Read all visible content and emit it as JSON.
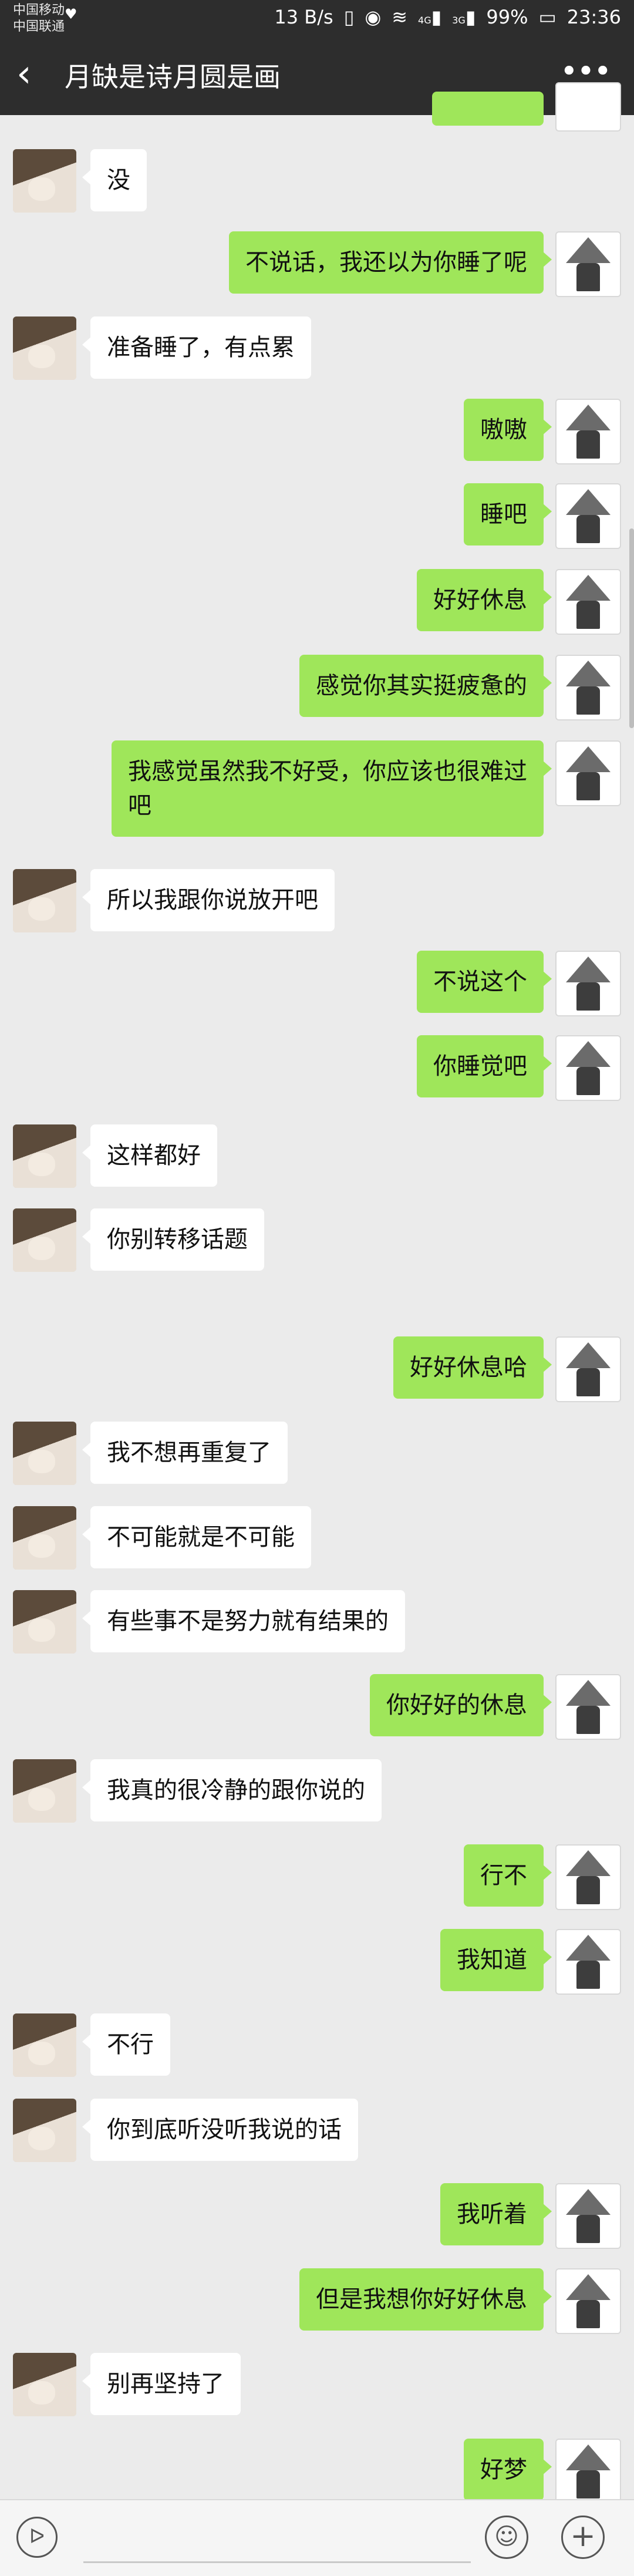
{
  "status_bar": {
    "carrier1": "中国移动",
    "carrier2": "中国联通",
    "speed": "13 B/s",
    "signal_4g": "4G",
    "signal_3g": "3G",
    "battery": "99%",
    "time": "23:36"
  },
  "header": {
    "title": "月缺是诗月圆是画"
  },
  "messages": [
    {
      "side": "left",
      "text": "没"
    },
    {
      "side": "right",
      "text": "不说话，我还以为你睡了呢"
    },
    {
      "side": "left",
      "text": "准备睡了，有点累"
    },
    {
      "side": "right",
      "text": "嗷嗷"
    },
    {
      "side": "right",
      "text": "睡吧"
    },
    {
      "side": "right",
      "text": "好好休息"
    },
    {
      "side": "right",
      "text": "感觉你其实挺疲惫的"
    },
    {
      "side": "right",
      "text": "我感觉虽然我不好受，你应该也很难过吧"
    },
    {
      "side": "left",
      "text": "所以我跟你说放开吧"
    },
    {
      "side": "right",
      "text": "不说这个"
    },
    {
      "side": "right",
      "text": "你睡觉吧"
    },
    {
      "side": "left",
      "text": "这样都好"
    },
    {
      "side": "left",
      "text": "你别转移话题"
    },
    {
      "side": "right",
      "text": "好好休息哈"
    },
    {
      "side": "left",
      "text": "我不想再重复了"
    },
    {
      "side": "left",
      "text": "不可能就是不可能"
    },
    {
      "side": "left",
      "text": "有些事不是努力就有结果的"
    },
    {
      "side": "right",
      "text": "你好好的休息"
    },
    {
      "side": "left",
      "text": "我真的很冷静的跟你说的"
    },
    {
      "side": "right",
      "text": "行不"
    },
    {
      "side": "right",
      "text": "我知道"
    },
    {
      "side": "left",
      "text": "不行"
    },
    {
      "side": "left",
      "text": "你到底听没听我说的话"
    },
    {
      "side": "right",
      "text": "我听着"
    },
    {
      "side": "right",
      "text": "但是我想你好好休息"
    },
    {
      "side": "left",
      "text": "别再坚持了"
    },
    {
      "side": "right",
      "text": "好梦"
    }
  ],
  "icons": {
    "back": "back-arrow-icon",
    "more": "more-dots-icon",
    "voice": "voice-icon",
    "emoji": "emoji-icon",
    "plus": "plus-icon"
  },
  "colors": {
    "header_bg": "#2d2d2d",
    "chat_bg": "#ebebeb",
    "sent_bubble": "#9fe65a",
    "received_bubble": "#ffffff"
  }
}
